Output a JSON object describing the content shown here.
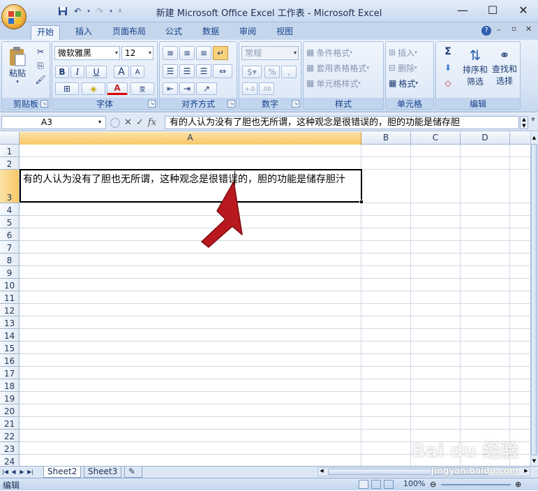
{
  "window": {
    "title": "新建 Microsoft Office Excel 工作表 - Microsoft Excel",
    "controls": {
      "minimize": "—",
      "maximize": "☐",
      "close": "✕"
    }
  },
  "qat": {
    "save_icon": "save-icon",
    "undo": "↶",
    "redo": "↷"
  },
  "ribbon_tabs": [
    "开始",
    "插入",
    "页面布局",
    "公式",
    "数据",
    "审阅",
    "视图"
  ],
  "active_tab": "开始",
  "ribbon": {
    "clipboard": {
      "label": "剪贴板",
      "paste": "粘贴"
    },
    "font": {
      "label": "字体",
      "font_name": "微软雅黑",
      "font_size": "12",
      "bold": "B",
      "italic": "I",
      "underline": "U",
      "grow": "A",
      "shrink": "A",
      "wen": "wén",
      "bian": "变"
    },
    "alignment": {
      "label": "对齐方式"
    },
    "number": {
      "label": "数字",
      "format": "常规",
      "percent": "%",
      "comma": ",",
      "inc": "+.0 .00",
      "dec": ".00 +.0"
    },
    "styles": {
      "label": "样式",
      "conditional": "条件格式",
      "table": "套用表格格式",
      "cell_styles": "单元格样式"
    },
    "cells": {
      "label": "单元格",
      "insert": "插入",
      "delete": "删除",
      "format": "格式"
    },
    "editing": {
      "label": "编辑",
      "sum": "Σ",
      "sort": "排序和",
      "filter": "筛选",
      "find": "查找和",
      "select": "选择"
    }
  },
  "formula_bar": {
    "name_box": "A3",
    "fx": "fx",
    "content": "有的人认为没有了胆也无所谓，这种观念是很错误的，胆的功能是储存胆"
  },
  "columns": [
    "A",
    "B",
    "C",
    "D"
  ],
  "rows": [
    "1",
    "2",
    "3",
    "4",
    "5",
    "6",
    "7",
    "8",
    "9",
    "10",
    "11",
    "12",
    "13",
    "14",
    "15",
    "16",
    "17",
    "18",
    "19",
    "20",
    "21",
    "22",
    "23",
    "24"
  ],
  "cell_a3": "有的人认为没有了胆也无所谓，这种观念是很错误的，胆的功能是储存胆汁",
  "sheets": [
    "Sheet2",
    "Sheet3"
  ],
  "status": {
    "mode": "编辑",
    "zoom": "100%"
  },
  "watermark": {
    "brand": "Bai du 经验",
    "url": "jingyan.baidu.com"
  },
  "colors": {
    "accent": "#c0282d",
    "ribbon": "#d4e2f4",
    "selected_header": "#f8c867"
  }
}
